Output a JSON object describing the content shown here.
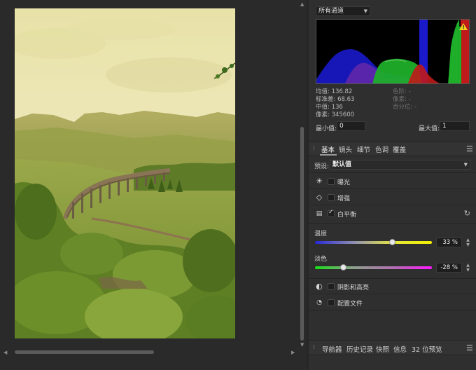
{
  "histogram": {
    "channel": "所有通道",
    "warning_color": "#f2d21e",
    "stats": {
      "mean_label": "均值:",
      "mean": "136.82",
      "stddev_label": "标准差:",
      "stddev": "68.63",
      "median_label": "中值:",
      "median": "136",
      "pixels_label": "像素:",
      "pixels": "345600",
      "level_label": "色阶:",
      "level": "-",
      "count_label": "像素:",
      "count": "-",
      "percentile_label": "百分位:",
      "percentile": "-"
    },
    "min_label": "最小值:",
    "min_value": "0",
    "max_label": "最大值:",
    "max_value": "1"
  },
  "tabs": {
    "items": [
      "基本",
      "镜头",
      "细节",
      "色调",
      "覆盖"
    ],
    "active": "基本"
  },
  "preset": {
    "label": "预设:",
    "value": "默认值"
  },
  "adjustments": {
    "exposure": {
      "label": "曝光",
      "checked": false,
      "icon": "sun-icon"
    },
    "enhance": {
      "label": "增强",
      "checked": false,
      "icon": "diamond-icon"
    },
    "white_balance": {
      "label": "白平衡",
      "checked": true,
      "icon": "white-balance-icon"
    },
    "shadows_highlights": {
      "label": "阴影和高亮",
      "checked": false,
      "icon": "half-circle-icon"
    },
    "profile": {
      "label": "配置文件",
      "checked": false,
      "icon": "profile-shapes-icon"
    }
  },
  "sliders": {
    "temperature": {
      "label": "温度",
      "value": "33 %",
      "level": 0.66
    },
    "tint": {
      "label": "淡色",
      "value": "-28 %",
      "level": 0.24
    }
  },
  "bottom_tabs": [
    "导航器",
    "历史记录",
    "快照",
    "信息",
    "32 位预览"
  ]
}
